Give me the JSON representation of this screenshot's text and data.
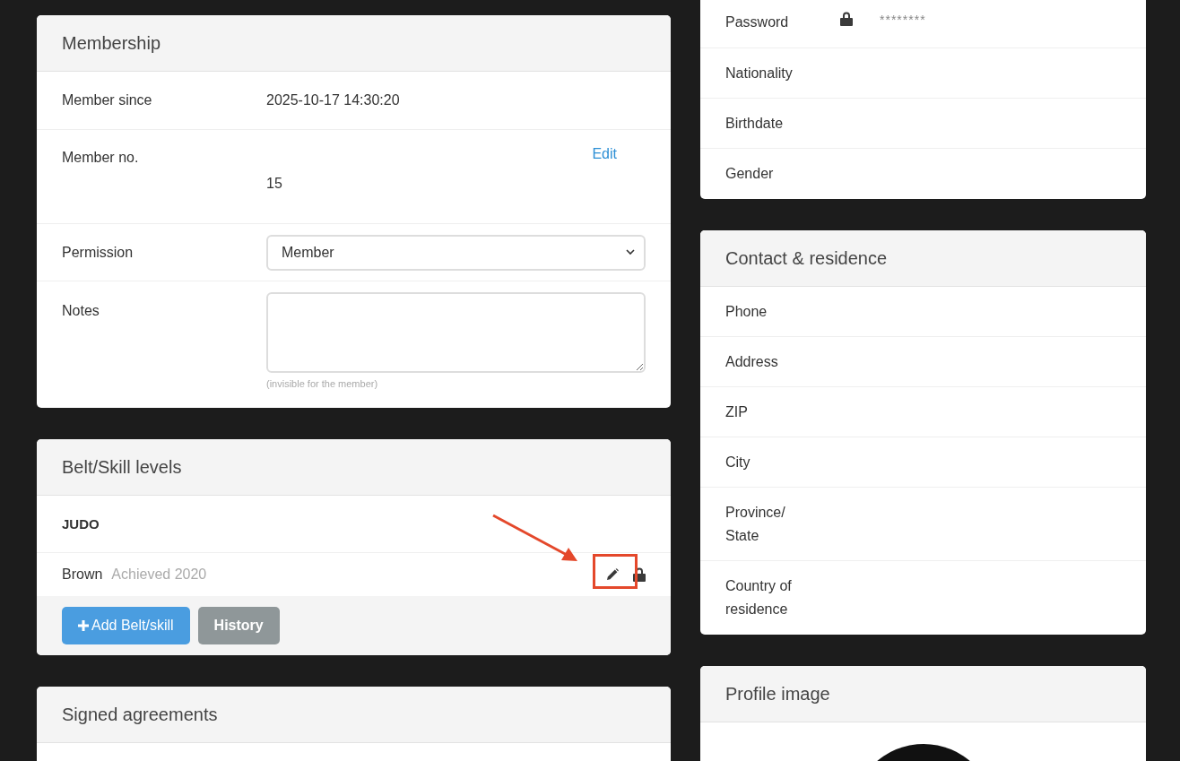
{
  "membership": {
    "title": "Membership",
    "rows": [
      {
        "kind": "text",
        "label": "Member since",
        "value": "2025-10-17 14:30:20"
      },
      {
        "kind": "editable",
        "label": "Member no.",
        "action": "Edit",
        "value": "15"
      },
      {
        "kind": "select",
        "label": "Permission",
        "value": "Member"
      },
      {
        "kind": "textarea",
        "label": "Notes",
        "hint": "(invisible for the member)"
      }
    ]
  },
  "belts": {
    "title": "Belt/Skill levels",
    "groups": [
      {
        "discipline": "JUDO",
        "levels": [
          {
            "name": "Brown",
            "achieved": "Achieved 2020",
            "locked": true,
            "annotated": true
          }
        ]
      }
    ],
    "buttons": [
      {
        "label": "Add Belt/skill",
        "kind": "primary"
      },
      {
        "label": "History",
        "kind": "secondary"
      }
    ]
  },
  "agreements": {
    "title": "Signed agreements"
  },
  "personal": {
    "rows": [
      {
        "label": "Password",
        "locked": true,
        "value": "********"
      },
      {
        "label": "Nationality",
        "locked": false
      },
      {
        "label": "Birthdate",
        "locked": false
      },
      {
        "label": "Gender",
        "locked": false
      }
    ]
  },
  "contact": {
    "title": "Contact & residence",
    "rows": [
      {
        "label": "Phone"
      },
      {
        "label": "Address"
      },
      {
        "label": "ZIP"
      },
      {
        "label": "City"
      },
      {
        "label": "Province/ State"
      },
      {
        "label": "Country of residence"
      }
    ]
  },
  "profile": {
    "title": "Profile image"
  }
}
